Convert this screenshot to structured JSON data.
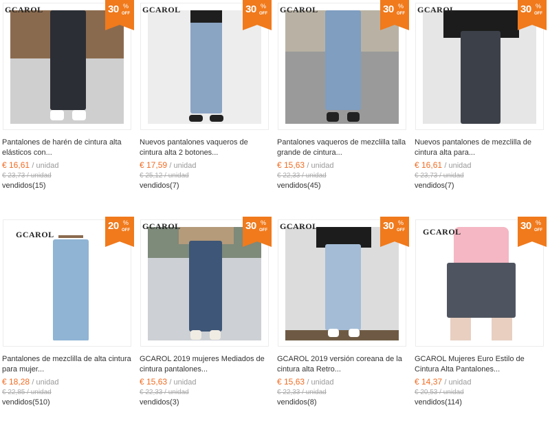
{
  "colors": {
    "badge": "#f07a1c",
    "price": "#f26b21"
  },
  "badge_off_label": "OFF",
  "products": [
    {
      "brand": "GCAROL",
      "discount": "30",
      "pct": "%",
      "title": "Pantalones de harén de cintura alta elásticos con...",
      "price": "€ 16,61",
      "unit": "/ unidad",
      "old_price": "€ 23,73 / unidad",
      "sold": "vendidos(15)"
    },
    {
      "brand": "GCAROL",
      "discount": "30",
      "pct": "%",
      "title": "Nuevos pantalones vaqueros de cintura alta 2 botones...",
      "price": "€ 17,59",
      "unit": "/ unidad",
      "old_price": "€ 25,12 / unidad",
      "sold": "vendidos(7)"
    },
    {
      "brand": "GCAROL",
      "discount": "30",
      "pct": "%",
      "title": "Pantalones vaqueros de mezclilla talla grande de cintura...",
      "price": "€ 15,63",
      "unit": "/ unidad",
      "old_price": "€ 22,33 / unidad",
      "sold": "vendidos(45)"
    },
    {
      "brand": "GCAROL",
      "discount": "30",
      "pct": "%",
      "title": "Nuevos pantalones de mezclilla de cintura alta para...",
      "price": "€ 16,61",
      "unit": "/ unidad",
      "old_price": "€ 23,73 / unidad",
      "sold": "vendidos(7)"
    },
    {
      "brand": "GCAROL",
      "discount": "20",
      "pct": "%",
      "title": "Pantalones de mezclilla de alta cintura para mujer...",
      "price": "€ 18,28",
      "unit": "/ unidad",
      "old_price": "€ 22,85 / unidad",
      "sold": "vendidos(510)"
    },
    {
      "brand": "GCAROL",
      "discount": "30",
      "pct": "%",
      "title": "GCAROL 2019 mujeres Mediados de cintura pantalones...",
      "price": "€ 15,63",
      "unit": "/ unidad",
      "old_price": "€ 22,33 / unidad",
      "sold": "vendidos(3)"
    },
    {
      "brand": "GCAROL",
      "discount": "30",
      "pct": "%",
      "title": "GCAROL 2019 versión coreana de la cintura alta Retro...",
      "price": "€ 15,63",
      "unit": "/ unidad",
      "old_price": "€ 22,33 / unidad",
      "sold": "vendidos(8)"
    },
    {
      "brand": "GCAROL",
      "discount": "30",
      "pct": "%",
      "title": "GCAROL Mujeres Euro Estilo de Cintura Alta Pantalones...",
      "price": "€ 14,37",
      "unit": "/ unidad",
      "old_price": "€ 20,53 / unidad",
      "sold": "vendidos(114)"
    }
  ]
}
